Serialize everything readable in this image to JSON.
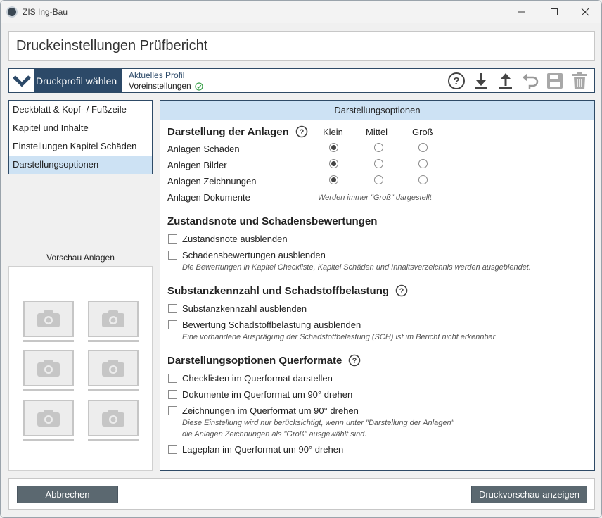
{
  "window": {
    "title": "ZIS Ing-Bau"
  },
  "header": {
    "title": "Druckeinstellungen Prüfbericht"
  },
  "profile": {
    "button_label": "Druckprofil wählen",
    "current_label": "Aktuelles Profil",
    "current_value": "Voreinstellungen"
  },
  "nav": {
    "items": [
      {
        "label": "Deckblatt & Kopf- / Fußzeile"
      },
      {
        "label": "Kapitel und Inhalte"
      },
      {
        "label": "Einstellungen Kapitel Schäden"
      },
      {
        "label": "Darstellungsoptionen"
      }
    ],
    "active_index": 3
  },
  "preview": {
    "label": "Vorschau Anlagen"
  },
  "panel": {
    "title": "Darstellungsoptionen",
    "anlagen": {
      "title": "Darstellung der Anlagen",
      "columns": [
        "Klein",
        "Mittel",
        "Groß"
      ],
      "rows": [
        {
          "label": "Anlagen Schäden",
          "selected": "Klein"
        },
        {
          "label": "Anlagen Bilder",
          "selected": "Klein"
        },
        {
          "label": "Anlagen Zeichnungen",
          "selected": "Klein"
        },
        {
          "label": "Anlagen Dokumente",
          "note": "Werden immer \"Groß\" dargestellt"
        }
      ]
    },
    "zustand": {
      "title": "Zustandsnote und Schadensbewertungen",
      "options": [
        {
          "label": "Zustandsnote ausblenden",
          "checked": false
        },
        {
          "label": "Schadensbewertungen ausblenden",
          "checked": false
        }
      ],
      "note": "Die Bewertungen in Kapitel Checkliste, Kapitel Schäden und Inhaltsverzeichnis werden ausgeblendet."
    },
    "substanz": {
      "title": "Substanzkennzahl und Schadstoffbelastung",
      "options": [
        {
          "label": "Substanzkennzahl ausblenden",
          "checked": false
        },
        {
          "label": "Bewertung Schadstoffbelastung ausblenden",
          "checked": false
        }
      ],
      "note": "Eine vorhandene Ausprägung der Schadstoffbelastung (SCH) ist im Bericht nicht erkennbar"
    },
    "quer": {
      "title": "Darstellungsoptionen Querformate",
      "options": [
        {
          "label": "Checklisten im Querformat darstellen",
          "checked": false
        },
        {
          "label": "Dokumente im Querformat um 90° drehen",
          "checked": false
        },
        {
          "label": "Zeichnungen im Querformat um 90° drehen",
          "checked": false
        },
        {
          "label": "Lageplan im Querformat um 90° drehen",
          "checked": false
        }
      ],
      "note_line1": "Diese Einstellung wird nur berücksichtigt, wenn unter \"Darstellung der Anlagen\"",
      "note_line2": "die Anlagen Zeichnungen als \"Groß\" ausgewählt sind."
    }
  },
  "footer": {
    "cancel_label": "Abbrechen",
    "preview_label": "Druckvorschau anzeigen"
  },
  "icons": {
    "help": "help-circle-icon",
    "download": "download-arrow-icon",
    "upload": "upload-arrow-icon",
    "undo": "undo-arrow-icon",
    "save": "save-disk-icon",
    "delete": "trash-icon",
    "status_ok": "check-circle-icon",
    "camera": "camera-icon"
  },
  "colors": {
    "accent": "#2c4968",
    "header_bg": "#cde2f4",
    "button_bg": "#5b6870",
    "ok_green": "#3aa04a"
  }
}
